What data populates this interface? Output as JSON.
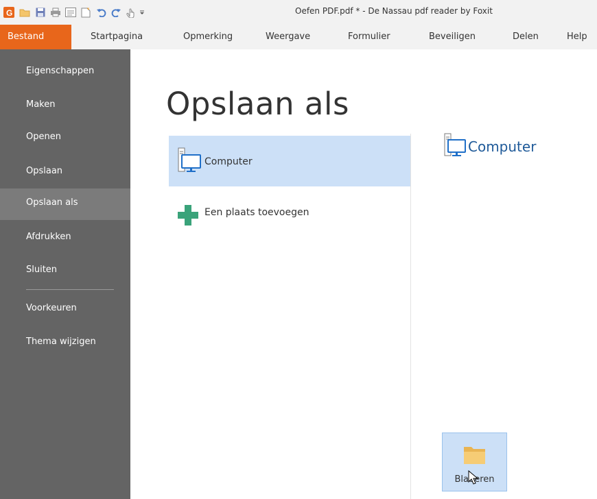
{
  "window": {
    "title": "Oefen PDF.pdf * - De Nassau pdf reader by Foxit"
  },
  "quick_access": [
    "app-logo-icon",
    "open-folder-icon",
    "save-icon",
    "print-icon",
    "properties-icon",
    "new-icon",
    "undo-icon",
    "redo-icon",
    "hand-tool-icon",
    "customize-dropdown-icon"
  ],
  "ribbon": {
    "tabs": [
      "Bestand",
      "Startpagina",
      "Opmerking",
      "Weergave",
      "Formulier",
      "Beveiligen",
      "Delen",
      "Help"
    ],
    "active_tab": "Bestand",
    "accent_color": "#e8661b"
  },
  "sidebar": {
    "items": [
      "Eigenschappen",
      "Maken",
      "Openen",
      "Opslaan",
      "Opslaan als",
      "Afdrukken",
      "Sluiten",
      "Voorkeuren",
      "Thema wijzigen"
    ],
    "active": "Opslaan als"
  },
  "main": {
    "title": "Opslaan als",
    "places": [
      {
        "label": "Computer",
        "icon": "computer-icon",
        "selected": true
      },
      {
        "label": "Een plaats toevoegen",
        "icon": "plus-icon",
        "selected": false
      }
    ],
    "detail": {
      "heading": "Computer",
      "browse_label": "Bladeren"
    }
  }
}
